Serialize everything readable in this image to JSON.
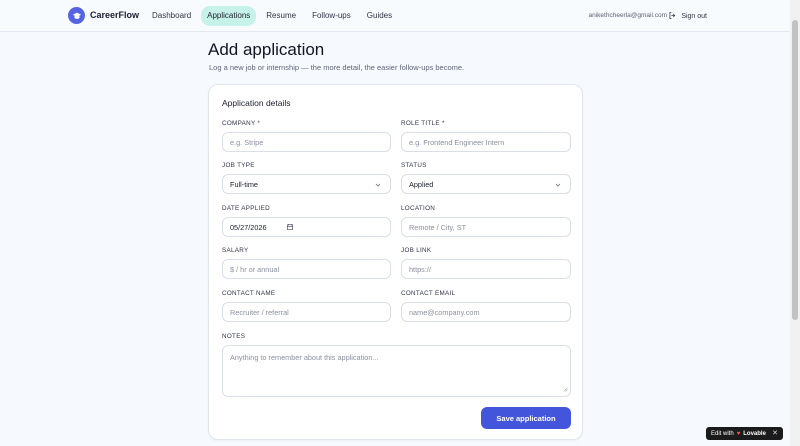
{
  "header": {
    "brand": "CareerFlow",
    "nav": [
      {
        "label": "Dashboard"
      },
      {
        "label": "Applications"
      },
      {
        "label": "Resume"
      },
      {
        "label": "Follow-ups"
      },
      {
        "label": "Guides"
      }
    ],
    "active_nav": "Applications",
    "user_email": "anikethcheerla@gmail.com",
    "signout_label": "Sign out"
  },
  "page": {
    "title": "Add application",
    "subtitle": "Log a new job or internship — the more detail, the easier follow-ups become."
  },
  "form": {
    "section_title": "Application details",
    "company": {
      "label": "COMPANY *",
      "placeholder": "e.g. Stripe"
    },
    "role_title": {
      "label": "ROLE TITLE *",
      "placeholder": "e.g. Frontend Engineer Intern"
    },
    "job_type": {
      "label": "JOB TYPE",
      "value": "Full-time"
    },
    "status": {
      "label": "STATUS",
      "value": "Applied"
    },
    "date_applied": {
      "label": "DATE APPLIED",
      "value": "05/27/2026"
    },
    "location": {
      "label": "LOCATION",
      "placeholder": "Remote / City, ST"
    },
    "salary": {
      "label": "SALARY",
      "placeholder": "$ / hr or annual"
    },
    "job_link": {
      "label": "JOB LINK",
      "placeholder": "https://"
    },
    "contact_name": {
      "label": "CONTACT NAME",
      "placeholder": "Recruiter / referral"
    },
    "contact_email": {
      "label": "CONTACT EMAIL",
      "placeholder": "name@company.com"
    },
    "notes": {
      "label": "NOTES",
      "placeholder": "Anything to remember about this application..."
    },
    "save_label": "Save application"
  },
  "badge": {
    "prefix": "Edit with",
    "brand": "Lovable",
    "close": "✕"
  },
  "colors": {
    "accent": "#4356db",
    "nav_active_bg": "#c6f2ea",
    "logo": "#5664e3"
  }
}
